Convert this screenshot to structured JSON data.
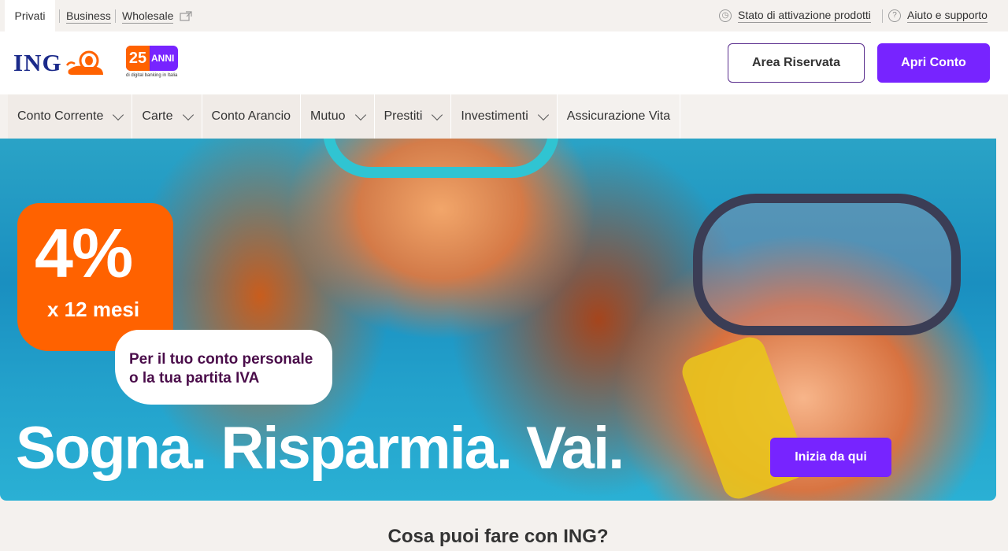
{
  "topbar": {
    "tabs": [
      "Privati",
      "Business",
      "Wholesale"
    ],
    "status_link": "Stato di attivazione prodotti",
    "help_link": "Aiuto e supporto"
  },
  "header": {
    "logo_text": "ING",
    "anniversary_number": "25",
    "anniversary_word": "ANNI",
    "anniversary_tagline": "di digital banking in Italia",
    "reserved_area_label": "Area Riservata",
    "open_account_label": "Apri Conto"
  },
  "nav": {
    "items": [
      {
        "label": "Conto Corrente",
        "dropdown": true
      },
      {
        "label": "Carte",
        "dropdown": true
      },
      {
        "label": "Conto Arancio",
        "dropdown": false
      },
      {
        "label": "Mutuo",
        "dropdown": true
      },
      {
        "label": "Prestiti",
        "dropdown": true
      },
      {
        "label": "Investimenti",
        "dropdown": true
      },
      {
        "label": "Assicurazione Vita",
        "dropdown": false
      }
    ]
  },
  "hero": {
    "rate": "4%",
    "period": "x 12 mesi",
    "promo_line1": "Per il tuo conto personale",
    "promo_line2": "o la tua partita IVA",
    "headline": "Sogna. Risparmia. Vai.",
    "cta_label": "Inizia da qui"
  },
  "section": {
    "title": "Cosa puoi fare con ING?"
  },
  "colors": {
    "accent_purple": "#7724ff",
    "brand_orange": "#ff6200",
    "brand_blue": "#1b2a8a"
  }
}
